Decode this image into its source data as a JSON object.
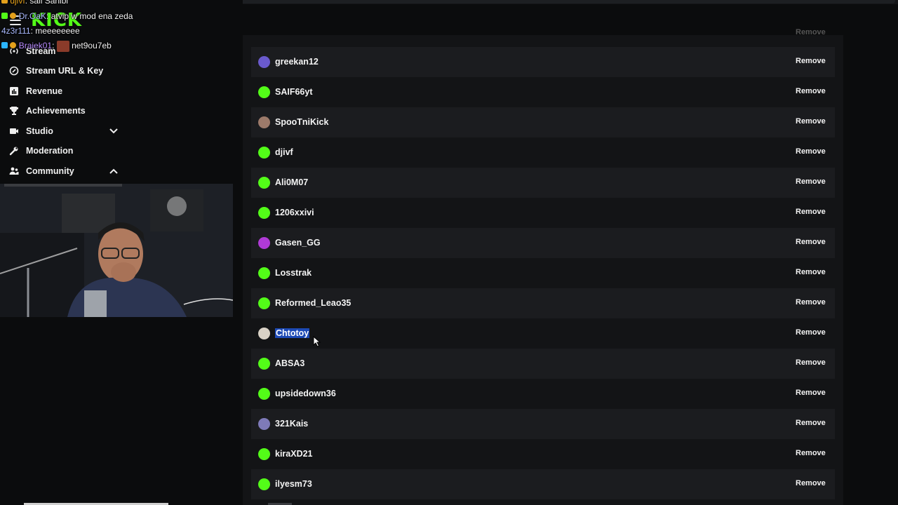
{
  "app": {
    "logo_text": "KICK"
  },
  "chat_overlay": [
    {
      "user": "djivf",
      "message": "sall Sahibi"
    },
    {
      "user": "Dr.OaK",
      "message": "atvip w mod ena zeda"
    },
    {
      "user": "4z3r111",
      "message": "meeeeeeee"
    },
    {
      "user": "Braiek01",
      "message": "net9ou7eb"
    }
  ],
  "sidebar": {
    "items": [
      {
        "label": "Stream",
        "icon": "broadcast-icon"
      },
      {
        "label": "Stream URL & Key",
        "icon": "link-icon"
      },
      {
        "label": "Revenue",
        "icon": "chart-icon"
      },
      {
        "label": "Achievements",
        "icon": "trophy-icon"
      },
      {
        "label": "Studio",
        "icon": "camera-icon",
        "chevron": "down"
      },
      {
        "label": "Moderation",
        "icon": "wrench-icon"
      },
      {
        "label": "Community",
        "icon": "people-icon",
        "chevron": "up"
      }
    ]
  },
  "list": {
    "action_label": "Remove",
    "users": [
      {
        "name": "greekan12",
        "avatar_color": "#6a5acd"
      },
      {
        "name": "SAIF66yt",
        "avatar_color": "#53fc18"
      },
      {
        "name": "SpooTniKick",
        "avatar_color": "#9c7a6a"
      },
      {
        "name": "djivf",
        "avatar_color": "#53fc18"
      },
      {
        "name": "Ali0M07",
        "avatar_color": "#53fc18"
      },
      {
        "name": "1206xxivi",
        "avatar_color": "#53fc18"
      },
      {
        "name": "Gasen_GG",
        "avatar_color": "#b03ad6"
      },
      {
        "name": "Losstrak",
        "avatar_color": "#53fc18"
      },
      {
        "name": "Reformed_Leao35",
        "avatar_color": "#53fc18"
      },
      {
        "name": "Chtotoy",
        "avatar_color": "#d9d2c6",
        "selected": true
      },
      {
        "name": "ABSA3",
        "avatar_color": "#53fc18"
      },
      {
        "name": "upsidedown36",
        "avatar_color": "#53fc18"
      },
      {
        "name": "321Kais",
        "avatar_color": "#7e7ab8"
      },
      {
        "name": "kiraXD21",
        "avatar_color": "#53fc18"
      },
      {
        "name": "ilyesm73",
        "avatar_color": "#53fc18"
      }
    ]
  }
}
